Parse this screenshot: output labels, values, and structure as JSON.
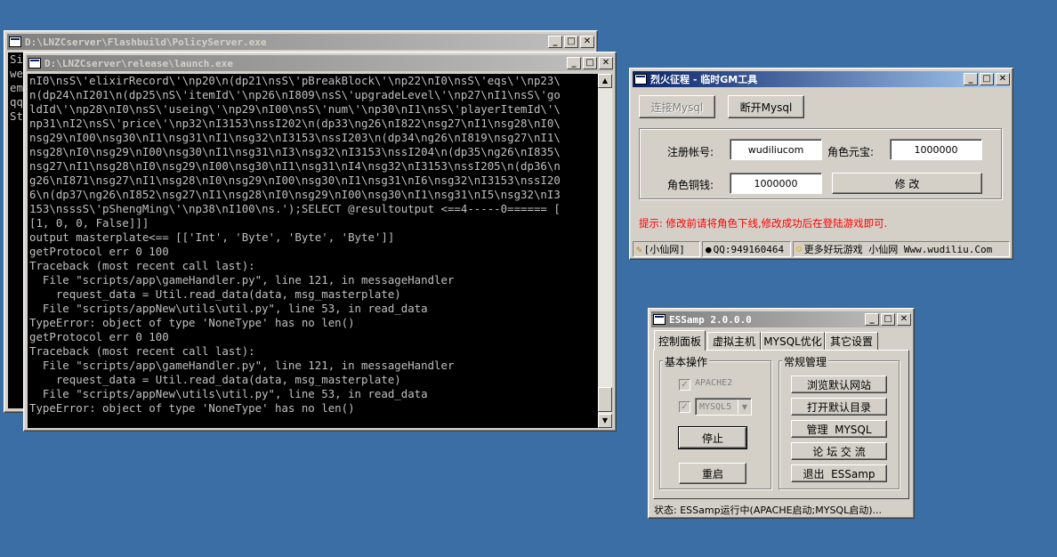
{
  "console1": {
    "title": "D:\\LNZCserver\\Flashbuild\\PolicyServer.exe",
    "lines": [
      "Si",
      "we",
      "em",
      "qq",
      "St"
    ]
  },
  "console2": {
    "title": "D:\\LNZCserver\\release\\launch.exe",
    "lines": [
      "nI0\\nsS\\'elixirRecord\\'\\np20\\n(dp21\\nsS\\'pBreakBlock\\'\\np22\\nI0\\nsS\\'eqs\\'\\np23\\",
      "n(dp24\\nI201\\n(dp25\\nS\\'itemId\\'\\np26\\nI809\\nsS\\'upgradeLevel\\'\\np27\\nI1\\nsS\\'go",
      "ldId\\'\\np28\\nI0\\nsS\\'useing\\'\\np29\\nI00\\nsS\\'num\\'\\np30\\nI1\\nsS\\'playerItemId\\'\\",
      "np31\\nI2\\nsS\\'price\\'\\np32\\nI3153\\nssI202\\n(dp33\\ng26\\nI822\\nsg27\\nI1\\nsg28\\nI0\\",
      "nsg29\\nI00\\nsg30\\nI1\\nsg31\\nI1\\nsg32\\nI3153\\nssI203\\n(dp34\\ng26\\nI819\\nsg27\\nI1\\",
      "nsg28\\nI0\\nsg29\\nI00\\nsg30\\nI1\\nsg31\\nI3\\nsg32\\nI3153\\nssI204\\n(dp35\\ng26\\nI835\\",
      "nsg27\\nI1\\nsg28\\nI0\\nsg29\\nI00\\nsg30\\nI1\\nsg31\\nI4\\nsg32\\nI3153\\nssI205\\n(dp36\\n",
      "g26\\nI871\\nsg27\\nI1\\nsg28\\nI0\\nsg29\\nI00\\nsg30\\nI1\\nsg31\\nI6\\nsg32\\nI3153\\nssI20",
      "6\\n(dp37\\ng26\\nI852\\nsg27\\nI1\\nsg28\\nI0\\nsg29\\nI00\\nsg30\\nI1\\nsg31\\nI5\\nsg32\\nI3",
      "153\\nsssS\\'pShengMing\\'\\np38\\nI100\\ns.');SELECT @resultoutput <==4-----0====== [",
      "[1, 0, 0, False]]]",
      "output masterplate<== [['Int', 'Byte', 'Byte', 'Byte']]",
      "getProtocol err 0 100",
      "Traceback (most recent call last):",
      "  File \"scripts/app\\gameHandler.py\", line 121, in messageHandler",
      "    request_data = Util.read_data(data, msg_masterplate)",
      "  File \"scripts/appNew\\utils\\util.py\", line 53, in read_data",
      "TypeError: object of type 'NoneType' has no len()",
      "getProtocol err 0 100",
      "Traceback (most recent call last):",
      "  File \"scripts/app\\gameHandler.py\", line 121, in messageHandler",
      "    request_data = Util.read_data(data, msg_masterplate)",
      "  File \"scripts/appNew\\utils\\util.py\", line 53, in read_data",
      "TypeError: object of type 'NoneType' has no len()"
    ]
  },
  "gm": {
    "title": "烈火征程 - 临时GM工具",
    "connect_label": "连接Mysql",
    "disconnect_label": "断开Mysql",
    "account_label": "注册帐号:",
    "account_value": "wudiliucom",
    "yuanbao_label": "角色元宝:",
    "yuanbao_value": "1000000",
    "copper_label": "角色铜钱:",
    "copper_value": "1000000",
    "modify_label": "修 改",
    "hint": "提示: 修改前请将角色下线,修改成功后在登陆游戏即可.",
    "status": [
      "[小仙网]",
      "QQ:949160464",
      "更多好玩游戏 小仙网 Www.wudiliu.Com"
    ]
  },
  "essamp": {
    "title": "ESSamp 2.0.0.0",
    "tabs": [
      "控制面板",
      "虚拟主机",
      "MYSQL优化",
      "其它设置"
    ],
    "basic_group": "基本操作",
    "general_group": "常规管理",
    "apache_label": "APACHE2",
    "mysql_label": "MYSQL5",
    "stop_label": "停止",
    "restart_label": "重启",
    "browse_label": "浏览默认网站",
    "open_dir_label": "打开默认目录",
    "manage_label": "管理  MYSQL",
    "forum_label": "论 坛 交 流",
    "exit_label": "退出  ESSamp",
    "status": "状态: ESSamp运行中(APACHE启动;MYSQL启动)..."
  },
  "colors": {
    "desktop": "#3a6ea5",
    "active_title": "#0a246a",
    "hint_red": "#ff0000"
  }
}
